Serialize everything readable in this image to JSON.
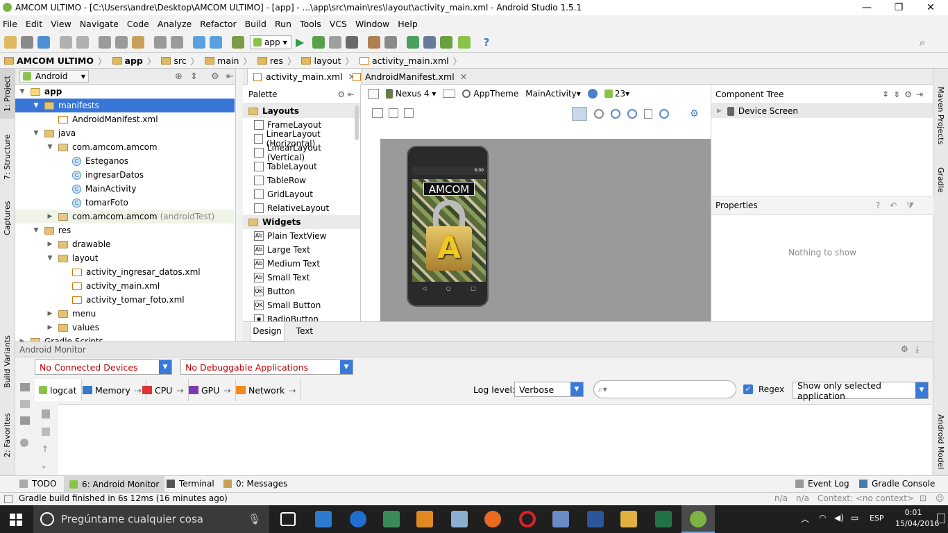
{
  "window": {
    "title": "AMCOM ULTIMO - [C:\\Users\\andre\\Desktop\\AMCOM ULTIMO] - [app] - ...\\app\\src\\main\\res\\layout\\activity_main.xml - Android Studio 1.5.1",
    "minimize": "—",
    "maximize": "❐",
    "close": "✕"
  },
  "menu": [
    "File",
    "Edit",
    "View",
    "Navigate",
    "Code",
    "Analyze",
    "Refactor",
    "Build",
    "Run",
    "Tools",
    "VCS",
    "Window",
    "Help"
  ],
  "toolbar": {
    "run_config": "app"
  },
  "breadcrumb": [
    "AMCOM ULTIMO",
    "app",
    "src",
    "main",
    "res",
    "layout",
    "activity_main.xml"
  ],
  "project_panel": {
    "view_selector": "Android",
    "tree": [
      {
        "label": "app",
        "indent": 0,
        "icon": "module",
        "arrow": "down",
        "bold": true
      },
      {
        "label": "manifests",
        "indent": 1,
        "icon": "folder",
        "arrow": "down",
        "selected": true
      },
      {
        "label": "AndroidManifest.xml",
        "indent": 2,
        "icon": "xml",
        "arrow": ""
      },
      {
        "label": "java",
        "indent": 1,
        "icon": "folder",
        "arrow": "down"
      },
      {
        "label": "com.amcom.amcom",
        "indent": 2,
        "icon": "package",
        "arrow": "down"
      },
      {
        "label": "Esteganos",
        "indent": 3,
        "icon": "class",
        "arrow": ""
      },
      {
        "label": "ingresarDatos",
        "indent": 3,
        "icon": "class",
        "arrow": ""
      },
      {
        "label": "MainActivity",
        "indent": 3,
        "icon": "class",
        "arrow": ""
      },
      {
        "label": "tomarFoto",
        "indent": 3,
        "icon": "class",
        "arrow": ""
      },
      {
        "label": "com.amcom.amcom",
        "suffix": "(androidTest)",
        "indent": 2,
        "icon": "package",
        "arrow": "right"
      },
      {
        "label": "res",
        "indent": 1,
        "icon": "folder",
        "arrow": "down"
      },
      {
        "label": "drawable",
        "indent": 2,
        "icon": "folder",
        "arrow": "right"
      },
      {
        "label": "layout",
        "indent": 2,
        "icon": "folder",
        "arrow": "down"
      },
      {
        "label": "activity_ingresar_datos.xml",
        "indent": 3,
        "icon": "xml",
        "arrow": ""
      },
      {
        "label": "activity_main.xml",
        "indent": 3,
        "icon": "xml",
        "arrow": ""
      },
      {
        "label": "activity_tomar_foto.xml",
        "indent": 3,
        "icon": "xml",
        "arrow": ""
      },
      {
        "label": "menu",
        "indent": 2,
        "icon": "folder",
        "arrow": "right"
      },
      {
        "label": "values",
        "indent": 2,
        "icon": "folder",
        "arrow": "right"
      },
      {
        "label": "Gradle Scripts",
        "indent": 0,
        "icon": "gradle",
        "arrow": "right"
      }
    ]
  },
  "left_strip": [
    "1: Project",
    "7: Structure",
    "Captures",
    "Build Variants",
    "2: Favorites"
  ],
  "right_strip": [
    "Maven Projects",
    "Gradle",
    "Android Model"
  ],
  "editor_tabs": [
    {
      "label": "activity_main.xml",
      "active": true
    },
    {
      "label": "AndroidManifest.xml",
      "active": false
    }
  ],
  "palette": {
    "title": "Palette",
    "sections": [
      {
        "name": "Layouts",
        "items": [
          "FrameLayout",
          "LinearLayout (Horizontal)",
          "LinearLayout (Vertical)",
          "TableLayout",
          "TableRow",
          "GridLayout",
          "RelativeLayout"
        ]
      },
      {
        "name": "Widgets",
        "items": [
          "Plain TextView",
          "Large Text",
          "Medium Text",
          "Small Text",
          "Button",
          "Small Button",
          "RadioButton"
        ]
      }
    ]
  },
  "designer_toolbar": {
    "device": "Nexus 4",
    "theme": "AppTheme",
    "activity": "MainActivity",
    "api": "23"
  },
  "phone": {
    "status_label": "AMCOM",
    "screen_letter": "A",
    "status_time": "6:00"
  },
  "component_tree": {
    "title": "Component Tree",
    "root": "Device Screen"
  },
  "properties": {
    "title": "Properties",
    "empty": "Nothing to show"
  },
  "design_tabs": [
    "Design",
    "Text"
  ],
  "monitor": {
    "title": "Android Monitor",
    "devices": "No Connected Devices",
    "apps": "No Debuggable Applications",
    "tabs": [
      "logcat",
      "Memory",
      "CPU",
      "GPU",
      "Network"
    ],
    "log_level_label": "Log level:",
    "log_level": "Verbose",
    "search_placeholder": "",
    "regex_label": "Regex",
    "filter": "Show only selected application"
  },
  "bottom_tools": {
    "left": [
      "TODO",
      "6: Android Monitor",
      "Terminal",
      "0: Messages"
    ],
    "right": [
      "Event Log",
      "Gradle Console"
    ]
  },
  "status": {
    "message": "Gradle build finished in 6s 12ms (16 minutes ago)",
    "na1": "n/a",
    "na2": "n/a",
    "context": "Context: <no context>"
  },
  "taskbar": {
    "search": "Pregúntame cualquier cosa",
    "lang": "ESP",
    "time": "0:01",
    "date": "15/04/2016"
  },
  "colors": {
    "selection": "#3875d7",
    "accent_blue": "#3879d9",
    "error_red": "#c00000"
  }
}
